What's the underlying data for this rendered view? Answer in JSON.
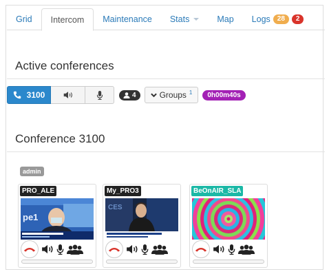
{
  "tabs": [
    {
      "label": "Grid"
    },
    {
      "label": "Intercom"
    },
    {
      "label": "Maintenance"
    },
    {
      "label": "Stats"
    },
    {
      "label": "Map"
    },
    {
      "label": "Logs",
      "badges": [
        "28",
        "2"
      ]
    }
  ],
  "active_tab": "Intercom",
  "active_conferences": {
    "title": "Active conferences",
    "conference_button": "3100",
    "participant_count": "4",
    "groups_label": "Groups",
    "groups_count": "1",
    "elapsed": "0h00m40s"
  },
  "conference": {
    "title": "Conference 3100",
    "role_tag": "admin",
    "participants": [
      {
        "name": "PRO_ALE",
        "video": "news-broadcast-icon"
      },
      {
        "name": "My_PRO3",
        "video": "news-broadcast-icon"
      },
      {
        "name": "BeOnAIR_SLA",
        "video": "test-pattern-icon"
      }
    ]
  },
  "colors": {
    "link": "#2a7ab8",
    "primary": "#2b88cc",
    "logs_badge_1": "#f0ad4e",
    "logs_badge_2": "#d9342b",
    "timer": "#a321b5",
    "teal_name": "#1bb8a6",
    "hangup": "#d9342b"
  }
}
